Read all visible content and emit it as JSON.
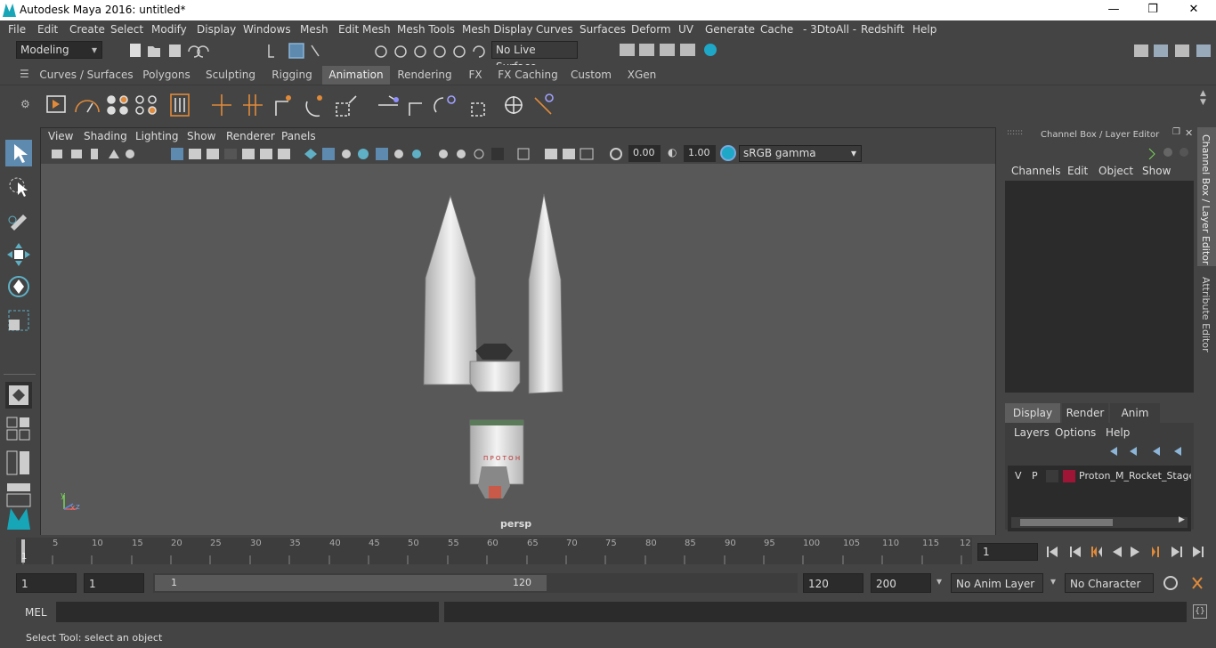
{
  "window": {
    "title": "Autodesk Maya 2016: untitled*",
    "min": "—",
    "max": "❐",
    "close": "✕"
  },
  "menu": [
    "File",
    "Edit",
    "Create",
    "Select",
    "Modify",
    "Display",
    "Windows",
    "Mesh",
    "Edit Mesh",
    "Mesh Tools",
    "Mesh Display",
    "Curves",
    "Surfaces",
    "Deform",
    "UV",
    "Generate",
    "Cache",
    "- 3DtoAll -",
    "Redshift",
    "Help"
  ],
  "status": {
    "mode": "Modeling",
    "live_surface": "No Live Surface"
  },
  "shelf_tabs": [
    "Curves / Surfaces",
    "Polygons",
    "Sculpting",
    "Rigging",
    "Animation",
    "Rendering",
    "FX",
    "FX Caching",
    "Custom",
    "XGen"
  ],
  "active_tab": "Animation",
  "viewport": {
    "menu": [
      "View",
      "Shading",
      "Lighting",
      "Show",
      "Renderer",
      "Panels"
    ],
    "exposure": "0.00",
    "gamma": "1.00",
    "color_space": "sRGB gamma",
    "camera": "persp",
    "axis_y": "y",
    "axis_x": "x",
    "axis_z": "z"
  },
  "channel_box": {
    "title": "Channel Box / Layer Editor",
    "menu": [
      "Channels",
      "Edit",
      "Object",
      "Show"
    ]
  },
  "layer_editor": {
    "tabs": [
      "Display",
      "Render",
      "Anim"
    ],
    "active": "Display",
    "menu": [
      "Layers",
      "Options",
      "Help"
    ],
    "layer": {
      "v": "V",
      "p": "P",
      "name": "Proton_M_Rocket_Stage_",
      "color": "#9e1535"
    }
  },
  "side_tabs": [
    "Channel Box / Layer Editor",
    "Attribute Editor"
  ],
  "timeline": {
    "ticks": [
      "1",
      "5",
      "10",
      "15",
      "20",
      "25",
      "30",
      "35",
      "40",
      "45",
      "50",
      "55",
      "60",
      "65",
      "70",
      "75",
      "80",
      "85",
      "90",
      "95",
      "100",
      "105",
      "110",
      "115",
      "12"
    ],
    "current": "1"
  },
  "range": {
    "start": "1",
    "start2": "1",
    "range_start": "1",
    "range_end": "120",
    "end": "120",
    "end2": "200",
    "anim_layer": "No Anim Layer",
    "char_set": "No Character Set"
  },
  "mel": {
    "label": "MEL"
  },
  "help_line": "Select Tool: select an object"
}
